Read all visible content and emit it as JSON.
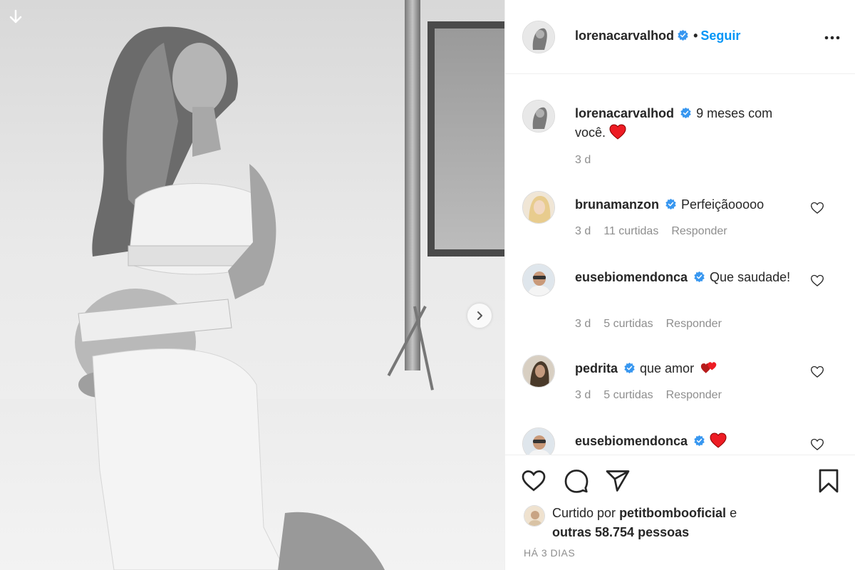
{
  "post": {
    "author": "lorenacarvalhod",
    "follow_label": "Seguir",
    "separator": "•",
    "caption_text": "9 meses com você.",
    "caption_time": "3 d"
  },
  "comments": [
    {
      "username": "brunamanzon",
      "text": "Perfeiçãooooo",
      "time": "3 d",
      "likes": "11 curtidas",
      "reply": "Responder"
    },
    {
      "username": "eusebiomendonca",
      "text": "Que saudade!",
      "time": "3 d",
      "likes": "5 curtidas",
      "reply": "Responder"
    },
    {
      "username": "pedrita",
      "text": "que amor",
      "time": "3 d",
      "likes": "5 curtidas",
      "reply": "Responder"
    },
    {
      "username": "eusebiomendonca",
      "text": "",
      "time": "",
      "likes": "",
      "reply": ""
    }
  ],
  "likes": {
    "prefix": "Curtido por",
    "user": "petitbombooficial",
    "connector": "e",
    "others": "outras 58.754 pessoas"
  },
  "post_time": "HÁ 3 DIAS",
  "icons": {
    "download": "arrow-down-icon",
    "next": "chevron-right-icon",
    "more": "more-horizontal-icon",
    "like": "heart-outline-icon",
    "comment": "comment-bubble-icon",
    "share": "paper-plane-icon",
    "save": "bookmark-icon",
    "verified": "verified-badge-icon"
  },
  "colors": {
    "link": "#0095f6",
    "verified": "#3897f0",
    "heart": "#ed1c24",
    "muted": "#8e8e8e"
  }
}
